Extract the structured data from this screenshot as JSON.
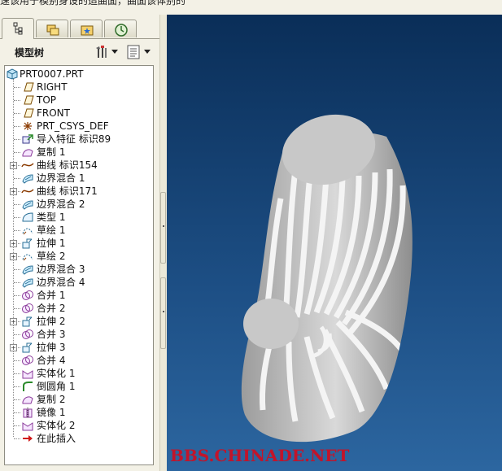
{
  "top_strip_text": "速该用于模别身设的造曲面，曲面该体别的",
  "tabs": [
    {
      "name": "model-tree-tab",
      "icon": "model-tree-icon",
      "active": true
    },
    {
      "name": "folder-browser-tab",
      "icon": "folders-icon",
      "active": false
    },
    {
      "name": "favorites-tab",
      "icon": "favorites-folder-icon",
      "active": false
    },
    {
      "name": "history-tab",
      "icon": "history-clock-icon",
      "active": false
    }
  ],
  "tree_panel": {
    "title": "模型树",
    "settings_button_icon": "tools-icon",
    "show_button_icon": "list-icon"
  },
  "tree": {
    "root": "PRT0007.PRT",
    "items": [
      {
        "label": "RIGHT",
        "icon": "datum-plane-icon",
        "expandable": false
      },
      {
        "label": "TOP",
        "icon": "datum-plane-icon",
        "expandable": false
      },
      {
        "label": "FRONT",
        "icon": "datum-plane-icon",
        "expandable": false
      },
      {
        "label": "PRT_CSYS_DEF",
        "icon": "csys-icon",
        "expandable": false
      },
      {
        "label": "导入特征 标识89",
        "icon": "import-feature-icon",
        "expandable": false
      },
      {
        "label": "复制 1",
        "icon": "copy-surface-icon",
        "expandable": false
      },
      {
        "label": "曲线 标识154",
        "icon": "curve-icon",
        "expandable": true
      },
      {
        "label": "边界混合 1",
        "icon": "boundary-blend-icon",
        "expandable": false
      },
      {
        "label": "曲线 标识171",
        "icon": "curve-icon",
        "expandable": true
      },
      {
        "label": "边界混合 2",
        "icon": "boundary-blend-icon",
        "expandable": false
      },
      {
        "label": "类型 1",
        "icon": "type-feature-icon",
        "expandable": false
      },
      {
        "label": "草绘 1",
        "icon": "sketch-icon",
        "expandable": false
      },
      {
        "label": "拉伸 1",
        "icon": "extrude-icon",
        "expandable": true
      },
      {
        "label": "草绘 2",
        "icon": "sketch-icon",
        "expandable": true
      },
      {
        "label": "边界混合 3",
        "icon": "boundary-blend-icon",
        "expandable": false
      },
      {
        "label": "边界混合 4",
        "icon": "boundary-blend-icon",
        "expandable": false
      },
      {
        "label": "合并 1",
        "icon": "merge-icon",
        "expandable": false
      },
      {
        "label": "合并 2",
        "icon": "merge-icon",
        "expandable": false
      },
      {
        "label": "拉伸 2",
        "icon": "extrude-icon",
        "expandable": true
      },
      {
        "label": "合并 3",
        "icon": "merge-icon",
        "expandable": false
      },
      {
        "label": "拉伸 3",
        "icon": "extrude-icon",
        "expandable": true
      },
      {
        "label": "合并 4",
        "icon": "merge-icon",
        "expandable": false
      },
      {
        "label": "实体化 1",
        "icon": "solidify-icon",
        "expandable": false
      },
      {
        "label": "倒圆角 1",
        "icon": "round-icon",
        "expandable": false
      },
      {
        "label": "复制 2",
        "icon": "copy-surface-icon",
        "expandable": false
      },
      {
        "label": "镜像 1",
        "icon": "mirror-icon",
        "expandable": false
      },
      {
        "label": "实体化 2",
        "icon": "solidify-icon",
        "expandable": false
      },
      {
        "label": "在此插入",
        "icon": "insert-here-arrow-icon",
        "expandable": false
      }
    ]
  },
  "viewport": {
    "watermark": "BBS.CHINADE.NET",
    "background_top": "#0a2e58",
    "background_bottom": "#2c66a0",
    "watermark_color": "#c2142a"
  }
}
